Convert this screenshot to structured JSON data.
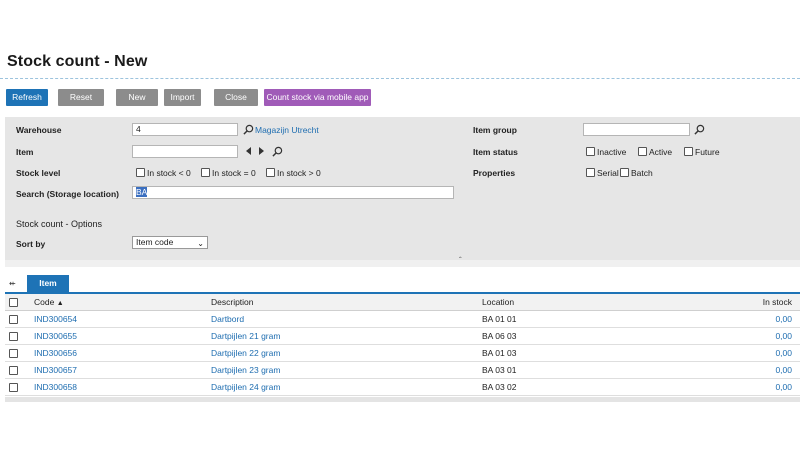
{
  "page": {
    "title": "Stock count - New"
  },
  "toolbar": {
    "refresh": "Refresh",
    "reset": "Reset",
    "new": "New",
    "import": "Import",
    "close": "Close",
    "count_mobile": "Count stock via mobile app"
  },
  "filters": {
    "warehouse_label": "Warehouse",
    "warehouse_value": "4",
    "warehouse_name": "Magazijn Utrecht",
    "item_label": "Item",
    "item_value": "",
    "stock_level_label": "Stock level",
    "stock_level_options": [
      "In stock < 0",
      "In stock = 0",
      "In stock > 0"
    ],
    "search_label": "Search (Storage location)",
    "search_value": "BA",
    "item_group_label": "Item group",
    "item_group_value": "",
    "item_status_label": "Item status",
    "item_status_options": [
      "Inactive",
      "Active",
      "Future"
    ],
    "properties_label": "Properties",
    "properties_options": [
      "Serial",
      "Batch"
    ]
  },
  "options": {
    "heading": "Stock count - Options",
    "sort_by_label": "Sort by",
    "sort_by_value": "Item code"
  },
  "tabs": {
    "item": "Item"
  },
  "grid": {
    "columns": [
      "Code",
      "Description",
      "Location",
      "In stock"
    ],
    "sort_indicator": "▲",
    "rows": [
      {
        "code": "IND300654",
        "description": "Dartbord",
        "location": "BA 01 01",
        "in_stock": "0,00"
      },
      {
        "code": "IND300655",
        "description": "Dartpijlen 21 gram",
        "location": "BA 06 03",
        "in_stock": "0,00"
      },
      {
        "code": "IND300656",
        "description": "Dartpijlen 22 gram",
        "location": "BA 01 03",
        "in_stock": "0,00"
      },
      {
        "code": "IND300657",
        "description": "Dartpijlen 23 gram",
        "location": "BA 03 01",
        "in_stock": "0,00"
      },
      {
        "code": "IND300658",
        "description": "Dartpijlen 24 gram",
        "location": "BA 03 02",
        "in_stock": "0,00"
      }
    ]
  },
  "colors": {
    "accent": "#1e73b6",
    "button_gray": "#8c8c8c",
    "mobile_button": "#a05bb8",
    "link": "#1e6db0",
    "panel": "#e6e6e6"
  },
  "icons": {
    "lookup": "magnifier-icon",
    "prev": "arrow-left-icon",
    "next": "arrow-right-icon",
    "pin": "pin-icon",
    "caret": "collapse-caret-icon"
  }
}
